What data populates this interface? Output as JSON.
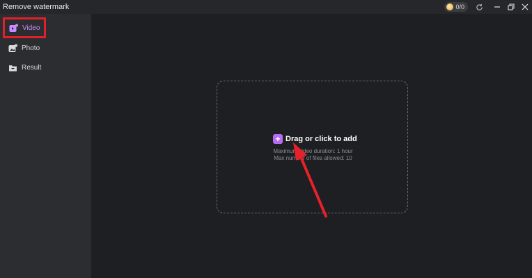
{
  "window": {
    "title": "Remove watermark",
    "credits": "0/0",
    "icons": [
      "coin-icon",
      "refresh-icon",
      "minimize-icon",
      "restore-icon",
      "close-icon"
    ]
  },
  "sidebar": {
    "items": [
      {
        "label": "Video",
        "icon": "video-add-icon",
        "active": true
      },
      {
        "label": "Photo",
        "icon": "photo-icon",
        "active": false
      },
      {
        "label": "Result",
        "icon": "folder-icon",
        "active": false
      }
    ]
  },
  "dropzone": {
    "action_label": "Drag or click to add",
    "hint_duration": "Maximum video duration: 1 hour",
    "hint_files": "Max number of files allowed: 10"
  },
  "colors": {
    "accent": "#b56cf0",
    "highlight": "#e0202a"
  }
}
